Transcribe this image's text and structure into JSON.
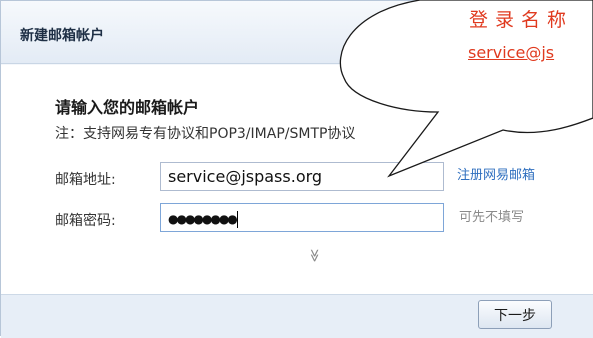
{
  "window": {
    "title": "新建邮箱帐户"
  },
  "form": {
    "heading": "请输入您的邮箱帐户",
    "note": "注：支持网易专有协议和POP3/IMAP/SMTP协议",
    "email_label": "邮箱地址:",
    "email_value": "service@jspass.org",
    "password_label": "邮箱密码:",
    "password_value": "●●●●●●●●",
    "register_link": "注册网易邮箱",
    "password_hint": "可先不填写",
    "expand_icon": "double-chevron-down",
    "expand_glyph": "≫"
  },
  "footer": {
    "next_label": "下一步"
  },
  "callout": {
    "line1": "登录名称",
    "line2": "service@js",
    "color": "#e03a1f"
  }
}
